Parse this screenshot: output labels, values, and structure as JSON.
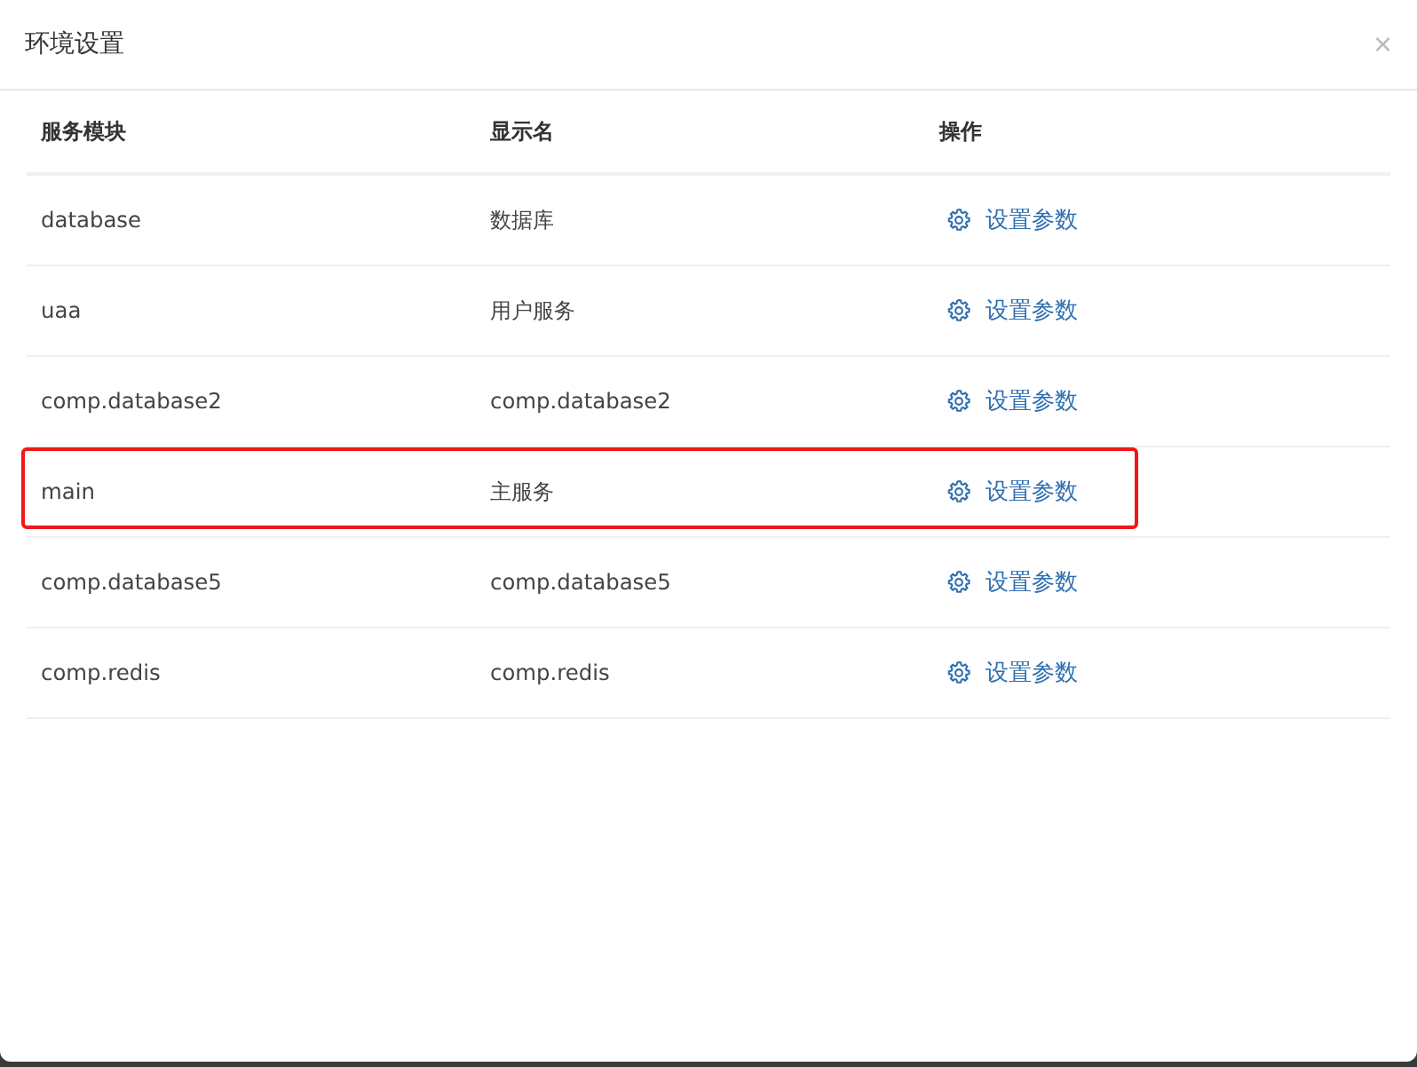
{
  "dialog": {
    "title": "环境设置",
    "close": "×"
  },
  "table": {
    "columns": [
      "服务模块",
      "显示名",
      "操作"
    ],
    "rows": [
      {
        "module": "database",
        "display_name": "数据库",
        "action": "设置参数",
        "highlighted": false
      },
      {
        "module": "uaa",
        "display_name": "用户服务",
        "action": "设置参数",
        "highlighted": false
      },
      {
        "module": "comp.database2",
        "display_name": "comp.database2",
        "action": "设置参数",
        "highlighted": false
      },
      {
        "module": "main",
        "display_name": "主服务",
        "action": "设置参数",
        "highlighted": true
      },
      {
        "module": "comp.database5",
        "display_name": "comp.database5",
        "action": "设置参数",
        "highlighted": false
      },
      {
        "module": "comp.redis",
        "display_name": "comp.redis",
        "action": "设置参数",
        "highlighted": false
      }
    ]
  }
}
